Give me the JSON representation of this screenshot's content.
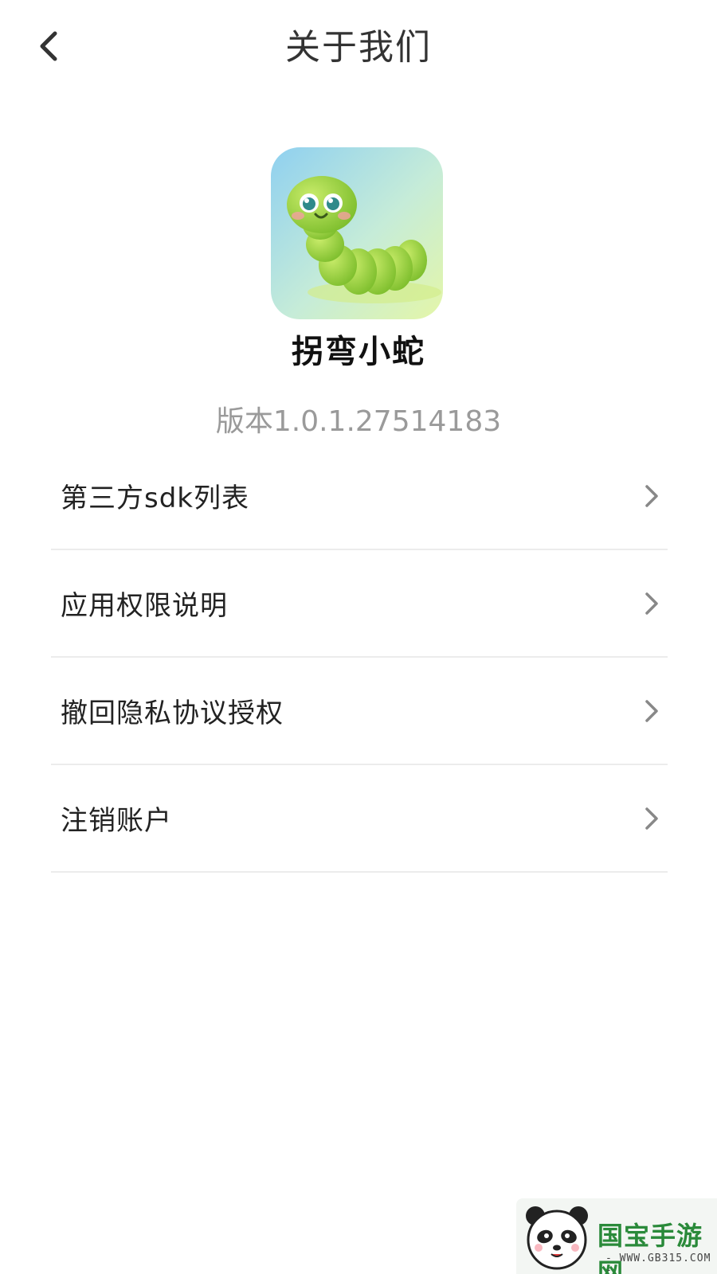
{
  "header": {
    "title": "关于我们",
    "back_icon": "chevron-left-icon"
  },
  "app": {
    "name": "拐弯小蛇",
    "version": "版本1.0.1.27514183",
    "icon": "caterpillar-icon"
  },
  "menu": {
    "items": [
      {
        "label": "第三方sdk列表",
        "icon": "chevron-right-icon"
      },
      {
        "label": "应用权限说明",
        "icon": "chevron-right-icon"
      },
      {
        "label": "撤回隐私协议授权",
        "icon": "chevron-right-icon"
      },
      {
        "label": "注销账户",
        "icon": "chevron-right-icon"
      }
    ]
  },
  "watermark": {
    "brand": "国宝手游网",
    "url": "- WWW.GB315.COM -",
    "logo": "panda-logo-icon"
  },
  "colors": {
    "background": "#ffffff",
    "title_text": "#333333",
    "version_text": "#9a9a9a",
    "divider": "#ececec",
    "chevron": "#888888"
  }
}
